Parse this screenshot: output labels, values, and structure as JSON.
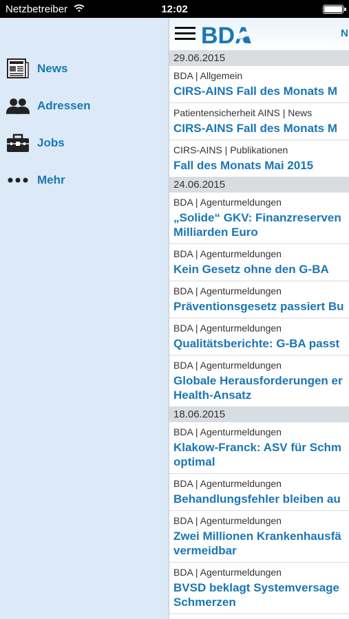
{
  "status": {
    "carrier": "Netzbetreiber",
    "time": "12:02"
  },
  "menu": [
    {
      "label": "News",
      "icon": "newspaper-icon"
    },
    {
      "label": "Adressen",
      "icon": "people-icon"
    },
    {
      "label": "Jobs",
      "icon": "briefcase-icon"
    },
    {
      "label": "Mehr",
      "icon": "more-dots-icon"
    }
  ],
  "header": {
    "logo": "BDA",
    "right_text": "N"
  },
  "colors": {
    "accent": "#1a76b5",
    "menu_bg": "#dbeaf6",
    "date_bg": "#d9dde0"
  },
  "sections": [
    {
      "date": "29.06.2015",
      "items": [
        {
          "category": "BDA | Allgemein",
          "title": "CIRS-AINS Fall des Monats M"
        },
        {
          "category": "Patientensicherheit AINS | News",
          "title": "CIRS-AINS Fall des Monats M"
        },
        {
          "category": "CIRS-AINS | Publikationen",
          "title": "Fall des Monats Mai 2015"
        }
      ]
    },
    {
      "date": "24.06.2015",
      "items": [
        {
          "category": "BDA | Agenturmeldungen",
          "title": "„Solide“ GKV: Finanzreserven",
          "title2": "Milliarden Euro"
        },
        {
          "category": "BDA | Agenturmeldungen",
          "title": "Kein Gesetz ohne den G-BA"
        },
        {
          "category": "BDA | Agenturmeldungen",
          "title": "Präventionsgesetz passiert Bu"
        },
        {
          "category": "BDA | Agenturmeldungen",
          "title": "Qualitätsberichte: G-BA passt"
        },
        {
          "category": "BDA | Agenturmeldungen",
          "title": "Globale Herausforderungen er",
          "title2": "Health-Ansatz"
        }
      ]
    },
    {
      "date": "18.06.2015",
      "items": [
        {
          "category": "BDA | Agenturmeldungen",
          "title": "Klakow-Franck: ASV für Schm",
          "title2": "optimal"
        },
        {
          "category": "BDA | Agenturmeldungen",
          "title": "Behandlungsfehler bleiben au"
        },
        {
          "category": "BDA | Agenturmeldungen",
          "title": "Zwei Millionen Krankenhausfä",
          "title2": "vermeidbar"
        },
        {
          "category": "BDA | Agenturmeldungen",
          "title": "BVSD beklagt Systemversage",
          "title2": "Schmerzen"
        }
      ]
    }
  ]
}
